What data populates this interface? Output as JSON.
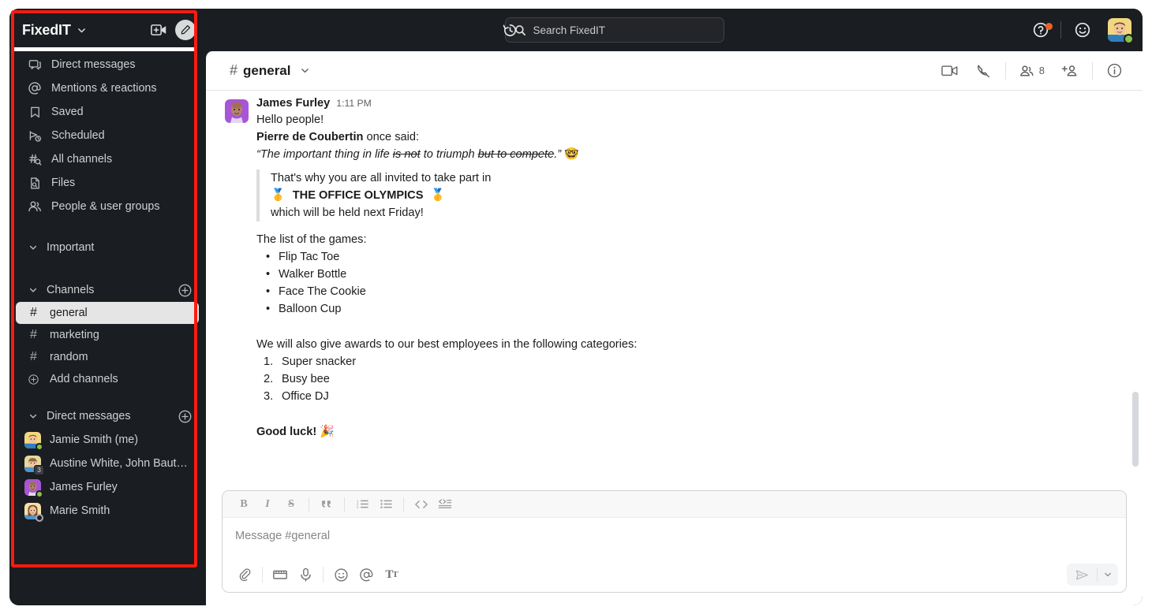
{
  "workspace": {
    "name": "FixedIT",
    "chevron_icon": "chevron-down-icon",
    "new_call_icon": "new-video-call-icon",
    "compose_icon": "compose-icon"
  },
  "topbar": {
    "history_icon": "history-icon",
    "search": {
      "placeholder": "Search FixedIT",
      "icon": "search-icon"
    },
    "help_icon": "help-icon",
    "emoji_icon": "smiley-icon",
    "avatar_name": "avatar"
  },
  "sidebar": {
    "nav_items": [
      {
        "label": "Direct messages",
        "icon": "direct-messages-icon"
      },
      {
        "label": "Mentions & reactions",
        "icon": "at-mention-icon"
      },
      {
        "label": "Saved",
        "icon": "bookmark-icon"
      },
      {
        "label": "Scheduled",
        "icon": "scheduled-send-icon"
      },
      {
        "label": "All channels",
        "icon": "all-channels-icon"
      },
      {
        "label": "Files",
        "icon": "files-icon"
      },
      {
        "label": "People & user groups",
        "icon": "people-groups-icon"
      }
    ],
    "sections": {
      "important": {
        "label": "Important"
      },
      "channels": {
        "label": "Channels",
        "add_label": "Add channels"
      },
      "direct_messages": {
        "label": "Direct messages"
      }
    },
    "channels": [
      {
        "label": "general",
        "active": true
      },
      {
        "label": "marketing",
        "active": false
      },
      {
        "label": "random",
        "active": false
      }
    ],
    "dms": [
      {
        "label": "Jamie Smith (me)",
        "status": "online"
      },
      {
        "label": "Austine White, John Baut…",
        "status": "group",
        "badge": "3"
      },
      {
        "label": "James Furley",
        "status": "online"
      },
      {
        "label": "Marie Smith",
        "status": "away"
      }
    ]
  },
  "channel_header": {
    "hash": "#",
    "name": "general",
    "caret_icon": "chevron-down-icon",
    "video_icon": "video-call-icon",
    "call_icon": "phone-call-icon",
    "members_icon": "members-icon",
    "members_count": "8",
    "add_person_icon": "add-person-icon",
    "info_icon": "info-icon"
  },
  "message": {
    "author": "James Furley",
    "time": "1:11 PM",
    "greeting": "Hello people!",
    "quote_attribution_bold": "Pierre de Coubertin",
    "quote_attribution_rest": " once said:",
    "quote_open": "“The important thing in life ",
    "quote_strike1": "is not",
    "quote_mid": " to triumph ",
    "quote_strike2": "but to compete",
    "quote_close": ".”",
    "quote_emoji": "🤓",
    "blockquote_line1": "That's why you are all invited to take part in",
    "blockquote_medal": "🥇",
    "blockquote_title": "THE OFFICE OLYMPICS",
    "blockquote_line3": "which will be held next Friday!",
    "games_intro": "The list of the games:",
    "games": [
      "Flip Tac Toe",
      "Walker Bottle",
      "Face The Cookie",
      "Balloon Cup"
    ],
    "awards_intro": "We will also give awards to our best employees in the following categories:",
    "awards": [
      "Super snacker",
      "Busy bee",
      "Office DJ"
    ],
    "closing": "Good luck!",
    "closing_emoji": "🎉"
  },
  "composer": {
    "placeholder": "Message #general",
    "format_buttons": [
      {
        "name": "bold-button",
        "glyph": "B"
      },
      {
        "name": "italic-button",
        "glyph": "I"
      },
      {
        "name": "strikethrough-button",
        "glyph": "S"
      },
      {
        "name": "blockquote-button",
        "glyph": "””"
      },
      {
        "name": "ordered-list-button",
        "glyph": "list"
      },
      {
        "name": "bulleted-list-button",
        "glyph": "list"
      },
      {
        "name": "code-button",
        "glyph": "<>"
      },
      {
        "name": "code-block-button",
        "glyph": "<>"
      }
    ],
    "action_icons": [
      "attachment-icon",
      "video-clip-icon",
      "audio-clip-icon",
      "emoji-icon",
      "mention-icon",
      "formatting-icon"
    ],
    "send_icon": "send-icon",
    "send_options_icon": "chevron-down-icon"
  },
  "colors": {
    "sidebar_bg": "#1a1d21",
    "accent_red": "#ff1a0f",
    "presence_green": "#8bc34a",
    "help_badge": "#e8622a",
    "active_channel_bg": "#e5e5e6"
  }
}
